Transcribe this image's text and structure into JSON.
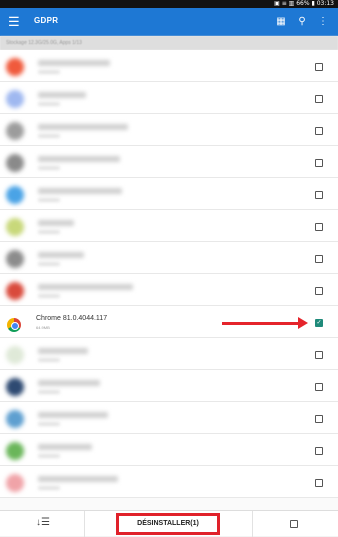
{
  "status_bar": {
    "right_text": "▣ ≡ ▥ 66% ▮ 03:13"
  },
  "app_bar": {
    "title": "GDPR",
    "menu_icon": "menu-icon",
    "actions": [
      "storage-icon",
      "search-icon",
      "more-vert-icon"
    ]
  },
  "subheader": {
    "text": "Stockage 12.3G/25.0G, Apps 1/13"
  },
  "rows": [
    {
      "icon_color": "#f05a3c",
      "bar_width": 72
    },
    {
      "icon_color": "#9fb8f0",
      "bar_width": 48
    },
    {
      "icon_color": "#9c9c9c",
      "bar_width": 90
    },
    {
      "icon_color": "#8a8a8a",
      "bar_width": 82
    },
    {
      "icon_color": "#4aa3e6",
      "bar_width": 84
    },
    {
      "icon_color": "#c8d87a",
      "bar_width": 36
    },
    {
      "icon_color": "#8c8c8c",
      "bar_width": 46
    },
    {
      "icon_color": "#d94a3c",
      "bar_width": 95
    },
    {
      "selected": true,
      "name": "Chrome 81.0.4044.117",
      "size": "64.9MB"
    },
    {
      "icon_color": "#dfe9d8",
      "bar_width": 50
    },
    {
      "icon_color": "#2e4a72",
      "bar_width": 62
    },
    {
      "icon_color": "#5e9fd0",
      "bar_width": 70
    },
    {
      "icon_color": "#6ab65a",
      "bar_width": 54
    },
    {
      "icon_color": "#f0a3a8",
      "bar_width": 80
    }
  ],
  "bottom_bar": {
    "sort_glyph": "↓☰",
    "uninstall_label": "DÉSINSTALLER(1)"
  },
  "annotation_colors": {
    "arrow": "#e5242b",
    "highlight": "#e0212a"
  }
}
